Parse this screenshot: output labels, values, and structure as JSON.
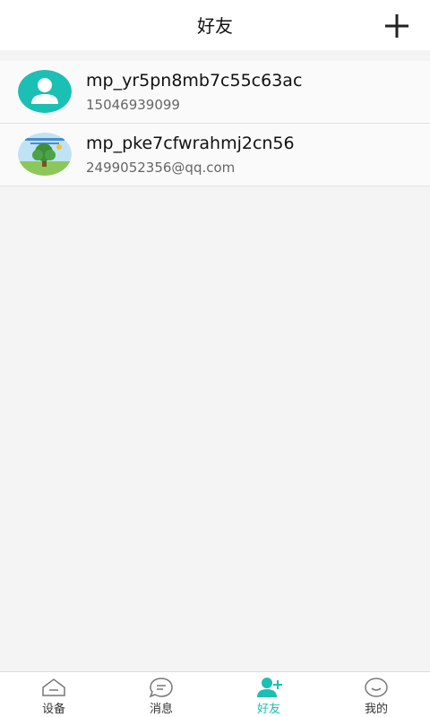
{
  "header": {
    "title": "好友",
    "add_icon": "plus-icon"
  },
  "friends": [
    {
      "name": "mp_yr5pn8mb7c55c63ac",
      "sub": "15046939099",
      "avatar": "default-user-avatar"
    },
    {
      "name": "mp_pke7cfwrahmj2cn56",
      "sub": "2499052356@qq.com",
      "avatar": "tree-photo-avatar"
    }
  ],
  "nav": {
    "items": [
      {
        "label": "设备",
        "icon": "device-icon",
        "active": false
      },
      {
        "label": "消息",
        "icon": "message-icon",
        "active": false
      },
      {
        "label": "好友",
        "icon": "add-friend-icon",
        "active": true
      },
      {
        "label": "我的",
        "icon": "smile-icon",
        "active": false
      }
    ]
  },
  "colors": {
    "accent": "#1bbfb4",
    "background": "#f4f4f4",
    "header_bg": "#ffffff"
  }
}
